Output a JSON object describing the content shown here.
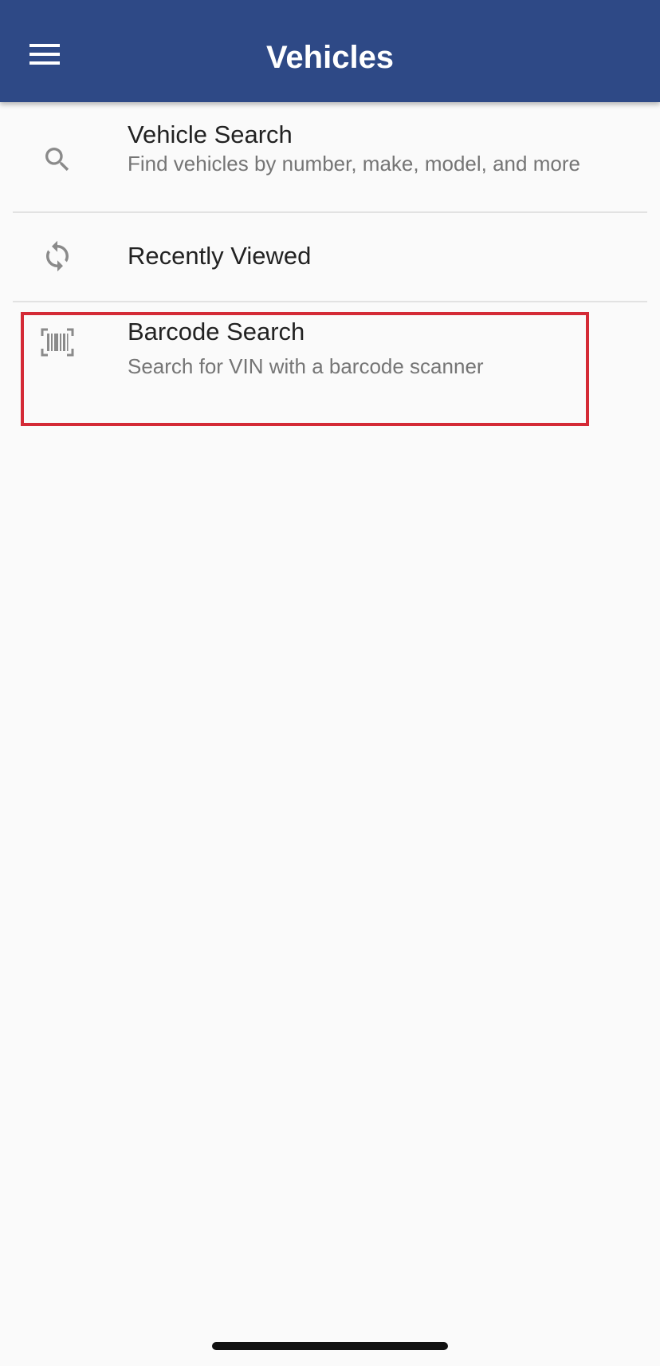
{
  "header": {
    "title": "Vehicles",
    "menu_icon": "hamburger-menu-icon"
  },
  "list": {
    "items": [
      {
        "title": "Vehicle Search",
        "subtitle": "Find vehicles by number, make, model, and more",
        "icon": "search-icon"
      },
      {
        "title": "Recently Viewed",
        "subtitle": "",
        "icon": "sync-icon"
      },
      {
        "title": "Barcode Search",
        "subtitle": "Search for VIN with a barcode scanner",
        "icon": "barcode-scan-icon",
        "highlighted": true
      }
    ]
  },
  "colors": {
    "app_bar": "#2e4986",
    "background": "#fafafa",
    "highlight": "#d42a36",
    "icon": "#8a8a8a"
  }
}
